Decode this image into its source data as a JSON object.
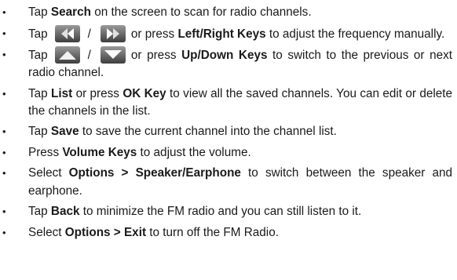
{
  "bullet_char": "•",
  "items": [
    {
      "p1": "Tap ",
      "b1": "Search",
      "p2": " on the screen to scan for radio channels."
    },
    {
      "p1": "Tap",
      "sep": "/",
      "p2": "or press ",
      "b1": "Left/Right Keys",
      "p3": " to adjust the frequency manually.",
      "icons": [
        "rewind-icon",
        "fast-forward-icon"
      ]
    },
    {
      "p1": "Tap",
      "sep": "/",
      "p2": "or press ",
      "b1": "Up/Down Keys",
      "p3": " to switch to the previous or next radio channel.",
      "icons": [
        "up-arrow-icon",
        "down-arrow-icon"
      ]
    },
    {
      "p1": "Tap ",
      "b1": "List",
      "p2": " or press ",
      "b2": "OK Key",
      "p3": " to view all the saved channels. You can edit or delete the channels in the list."
    },
    {
      "p1": "Tap ",
      "b1": "Save",
      "p2": " to save the current channel into the channel list."
    },
    {
      "p1": "Press ",
      "b1": "Volume Keys",
      "p2": " to adjust the volume."
    },
    {
      "p1": "Select ",
      "b1": "Options > Speaker/Earphone",
      "p2": " to switch between the speaker and earphone."
    },
    {
      "p1": "Tap ",
      "b1": "Back",
      "p2": " to minimize the FM radio and you can still listen to it."
    },
    {
      "p1": "Select ",
      "b1": "Options > Exit",
      "p2": " to turn off the FM Radio."
    }
  ],
  "colors": {
    "text": "#1a1a1a",
    "icon_gradient_top": "#9a9a9a",
    "icon_gradient_bottom": "#3e3e3e",
    "icon_glyph_light": "#d8d8d8",
    "icon_glyph_dark": "#ffffff"
  }
}
